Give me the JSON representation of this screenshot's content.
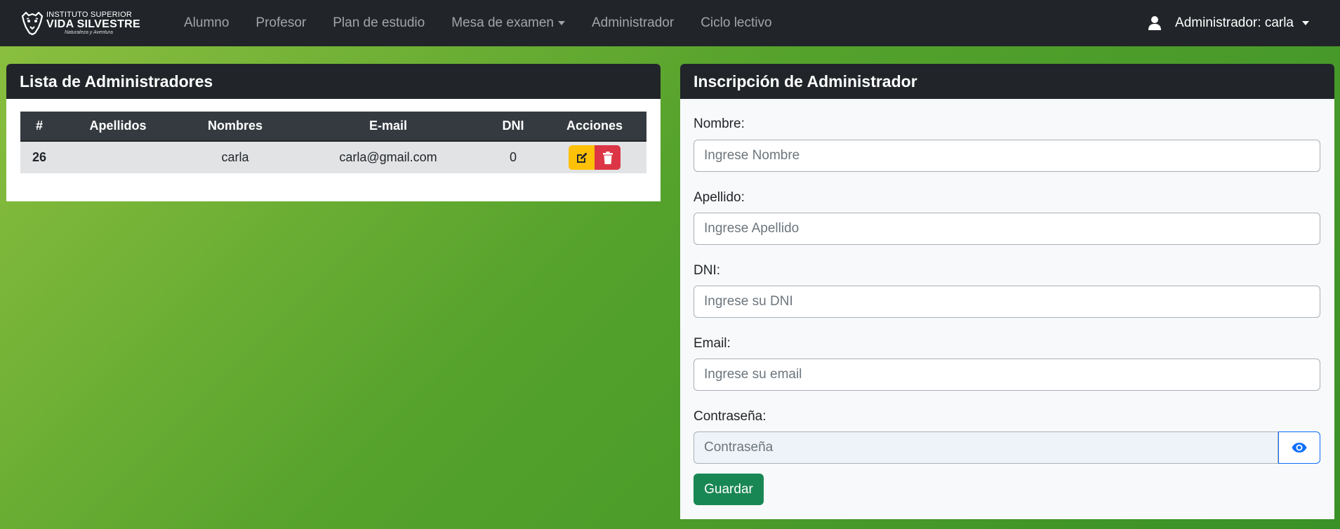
{
  "navbar": {
    "brand": {
      "line1": "INSTITUTO SUPERIOR",
      "line2": "VIDA SILVESTRE",
      "line3": "Naturaleza y Aventura"
    },
    "links": [
      {
        "label": "Alumno"
      },
      {
        "label": "Profesor"
      },
      {
        "label": "Plan de estudio"
      },
      {
        "label": "Mesa de examen"
      },
      {
        "label": "Administrador"
      },
      {
        "label": "Ciclo lectivo"
      }
    ],
    "user_label": "Administrador: carla"
  },
  "admin_list": {
    "title": "Lista de Administradores",
    "columns": [
      "#",
      "Apellidos",
      "Nombres",
      "E-mail",
      "DNI",
      "Acciones"
    ],
    "rows": [
      {
        "id": "26",
        "apellidos": "",
        "nombres": "carla",
        "email": "carla@gmail.com",
        "dni": "0"
      }
    ]
  },
  "form": {
    "title": "Inscripción de Administrador",
    "nombre_label": "Nombre:",
    "nombre_placeholder": "Ingrese Nombre",
    "apellido_label": "Apellido:",
    "apellido_placeholder": "Ingrese Apellido",
    "dni_label": "DNI:",
    "dni_placeholder": "Ingrese su DNI",
    "email_label": "Email:",
    "email_placeholder": "Ingrese su email",
    "password_label": "Contraseña:",
    "password_placeholder": "Contraseña",
    "save_label": "Guardar"
  },
  "colors": {
    "navbar_bg": "#212529",
    "edit_button": "#ffc107",
    "delete_button": "#dc3545",
    "save_button": "#198754",
    "eye_icon": "#0d6efd"
  },
  "icons": {
    "logo": "jaguar-logo-icon",
    "user": "user-icon",
    "edit": "edit-icon",
    "delete": "trash-icon",
    "show_password": "eye-icon"
  }
}
